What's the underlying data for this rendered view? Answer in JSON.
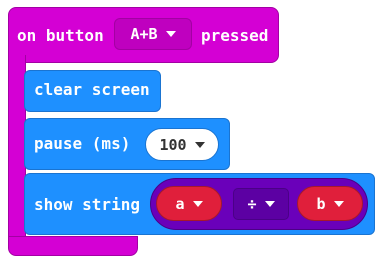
{
  "event_block": {
    "prefix": "on button",
    "button": "A+B",
    "suffix": "pressed"
  },
  "blocks": {
    "clear": "clear screen",
    "pause_label": "pause (ms)",
    "pause_value": "100",
    "show_label": "show string",
    "arg_a": "a",
    "operator": "÷",
    "arg_b": "b"
  },
  "colors": {
    "event": "#d400d4",
    "basic": "#1e90ff",
    "math": "#6a00ba",
    "value": "#e01f3b"
  }
}
